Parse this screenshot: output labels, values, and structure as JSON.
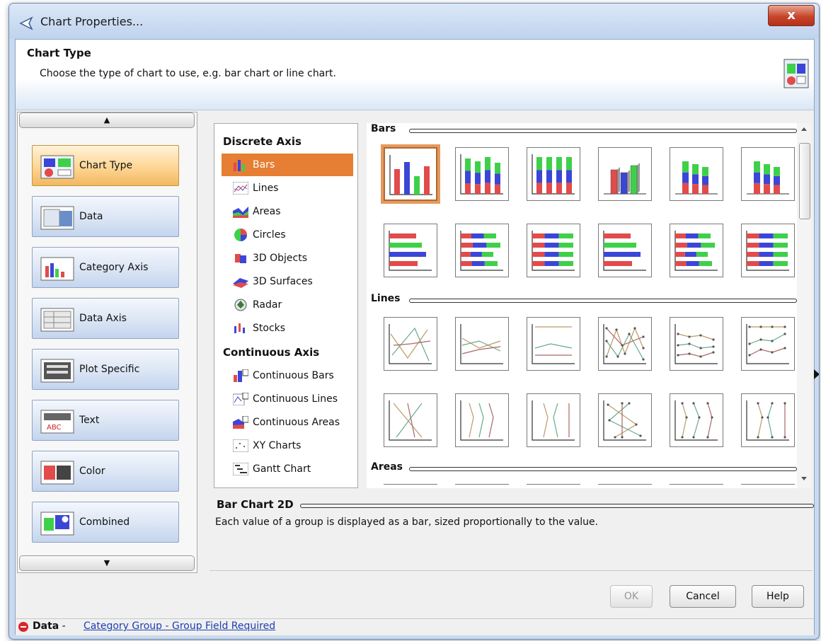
{
  "window": {
    "title": "Chart Properties...",
    "close_label": "x"
  },
  "header": {
    "title": "Chart Type",
    "subtitle": "Choose the type of chart to use, e.g. bar chart or line chart."
  },
  "nav": {
    "up_arrow": "▲",
    "down_arrow": "▼",
    "items": [
      {
        "label": "Chart Type",
        "icon": "chart-type-icon",
        "selected": true
      },
      {
        "label": "Data",
        "icon": "data-icon",
        "selected": false
      },
      {
        "label": "Category Axis",
        "icon": "category-axis-icon",
        "selected": false
      },
      {
        "label": "Data Axis",
        "icon": "data-axis-icon",
        "selected": false
      },
      {
        "label": "Plot Specific",
        "icon": "plot-specific-icon",
        "selected": false
      },
      {
        "label": "Text",
        "icon": "text-icon",
        "selected": false
      },
      {
        "label": "Color",
        "icon": "color-icon",
        "selected": false
      },
      {
        "label": "Combined",
        "icon": "combined-icon",
        "selected": false
      }
    ]
  },
  "categories": {
    "discrete_header": "Discrete Axis",
    "discrete": [
      "Bars",
      "Lines",
      "Areas",
      "Circles",
      "3D Objects",
      "3D Surfaces",
      "Radar",
      "Stocks"
    ],
    "continuous_header": "Continuous Axis",
    "continuous": [
      "Continuous Bars",
      "Continuous Lines",
      "Continuous Areas",
      "XY Charts",
      "Gantt Chart"
    ],
    "selected": "Bars"
  },
  "gallery": {
    "sections": [
      "Bars",
      "Lines",
      "Areas"
    ],
    "selected_index": 0
  },
  "description": {
    "title": "Bar Chart 2D",
    "text": "Each value of a group is displayed as a bar, sized proportionally to the value."
  },
  "buttons": {
    "ok": "OK",
    "cancel": "Cancel",
    "help": "Help"
  },
  "status": {
    "label": "Data",
    "separator": " - ",
    "link": "Category Group - Group Field Required"
  },
  "colors": {
    "accent": "#e67e33",
    "red": "#e24b4b",
    "blue": "#3b46d6",
    "green": "#3fd04a"
  }
}
